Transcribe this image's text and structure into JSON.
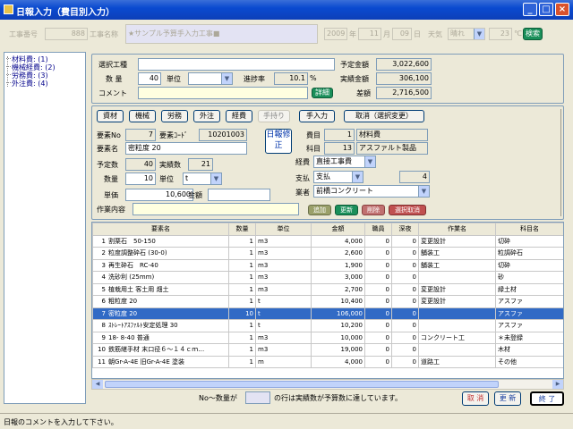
{
  "window": {
    "title": "日報入力（費目別入力）"
  },
  "header": {
    "kouji_no_label": "工事番号",
    "kouji_no": "888",
    "kouji_name_label": "工事名称",
    "kouji_name": "★サンプル予算手入力工事■",
    "year": "2009",
    "year_unit": "年",
    "month": "11",
    "month_unit": "月",
    "day": "09",
    "day_unit": "日",
    "weather_label": "天気",
    "weather": "晴れ",
    "temp": "23",
    "temp_unit": "℃",
    "search_btn": "検索"
  },
  "sidebar": {
    "items": [
      {
        "label": "材料費: (1)"
      },
      {
        "label": "機械経費: (2)"
      },
      {
        "label": "労務費: (3)"
      },
      {
        "label": "外注費: (4)"
      }
    ]
  },
  "top_panel": {
    "select_label": "選択工種",
    "select_value": "",
    "qty_label": "数 量",
    "qty": "40",
    "unit_label": "単位",
    "unit": "",
    "rate_label": "進捗率",
    "rate": "10.1",
    "rate_unit": "%",
    "comment_label": "コメント",
    "comment": "",
    "detail_btn": "詳細",
    "budget_label": "予定金額",
    "budget": "3,022,600",
    "actual_label": "実績金額",
    "actual": "306,100",
    "diff_label": "差額",
    "diff": "2,716,500"
  },
  "tabs": [
    {
      "label": "資材"
    },
    {
      "label": "機械"
    },
    {
      "label": "労務"
    },
    {
      "label": "外注"
    },
    {
      "label": "経費"
    },
    {
      "label": "手持り"
    },
    {
      "label": "手入力"
    }
  ],
  "cancel_select_btn": "取消（選択変更）",
  "detail": {
    "youso_no_label": "要素No",
    "youso_no": "7",
    "youso_code_label": "要素ｺｰﾄﾞ",
    "youso_code": "10201003",
    "nippo_btn": "日報修正",
    "himoku_label": "費目",
    "himoku_no": "1",
    "himoku_name": "材料費",
    "youso_name_label": "要素名",
    "youso_name": "密粒度 20",
    "kamoku_label": "科目",
    "kamoku_no": "13",
    "kamoku_name": "アスファルト製品",
    "yotei_qty_label": "予定数",
    "yotei_qty": "40",
    "jisseki_qty_label": "実績数",
    "jisseki_qty": "21",
    "keihi_label": "経費",
    "keihi": "直接工事費",
    "qty_label": "数量",
    "qty": "10",
    "unit_label": "単位",
    "unit": "t",
    "shiharai_label": "支払",
    "shiharai": "支払",
    "shiharai_no": "4",
    "tanka_label": "単価",
    "tanka": "10,600",
    "kingaku_label": "金額",
    "kingaku": "",
    "gyousha_label": "業者",
    "gyousha": "前橋コンクリート",
    "work_label": "作業内容",
    "work": "",
    "btn_add": "追加",
    "btn_update": "更新",
    "btn_delete": "削除",
    "btn_cancel": "選択取消"
  },
  "table": {
    "headers": [
      "要素名",
      "数量",
      "単位",
      "金額",
      "職員",
      "深夜",
      "作業名",
      "科目名"
    ],
    "rows": [
      {
        "no": "1",
        "name": "割栗石　50-150",
        "qty": "1",
        "unit": "m3",
        "amount": "4,000",
        "staff": "0",
        "night": "0",
        "work": "変更設計",
        "kamoku": "切砕"
      },
      {
        "no": "2",
        "name": "粒度調整砕石 (30-0)",
        "qty": "1",
        "unit": "m3",
        "amount": "2,600",
        "staff": "0",
        "night": "0",
        "work": "舗装工",
        "kamoku": "粒調砕石"
      },
      {
        "no": "3",
        "name": "再生砕石　RC-40",
        "qty": "1",
        "unit": "m3",
        "amount": "1,900",
        "staff": "0",
        "night": "0",
        "work": "舗装工",
        "kamoku": "切砕"
      },
      {
        "no": "4",
        "name": "洗砂利 (25mm)",
        "qty": "1",
        "unit": "m3",
        "amount": "3,000",
        "staff": "0",
        "night": "0",
        "work": "",
        "kamoku": "砂"
      },
      {
        "no": "5",
        "name": "植栽用土 客土用 畑土",
        "qty": "1",
        "unit": "m3",
        "amount": "2,700",
        "staff": "0",
        "night": "0",
        "work": "変更設計",
        "kamoku": "緑土材"
      },
      {
        "no": "6",
        "name": "粗粒度 20",
        "qty": "1",
        "unit": "t",
        "amount": "10,400",
        "staff": "0",
        "night": "0",
        "work": "変更設計",
        "kamoku": "アスファ"
      },
      {
        "no": "7",
        "name": "密粒度 20",
        "qty": "10",
        "unit": "t",
        "amount": "106,000",
        "staff": "0",
        "night": "0",
        "work": "",
        "kamoku": "アスファ"
      },
      {
        "no": "8",
        "name": "ｽﾄﾚｰﾄｱｽﾌｧﾙﾄ安定処理 30",
        "qty": "1",
        "unit": "t",
        "amount": "10,200",
        "staff": "0",
        "night": "0",
        "work": "",
        "kamoku": "アスファ"
      },
      {
        "no": "9",
        "name": "18- 8-40 普通",
        "qty": "1",
        "unit": "m3",
        "amount": "10,000",
        "staff": "0",
        "night": "0",
        "work": "コンクリート工",
        "kamoku": "＊未登録"
      },
      {
        "no": "10",
        "name": "鉄筋継手材 末口径６～１４ｃｍ…",
        "qty": "1",
        "unit": "m3",
        "amount": "19,000",
        "staff": "0",
        "night": "0",
        "work": "",
        "kamoku": "木材"
      },
      {
        "no": "11",
        "name": "朝Gr-A-4E 旧Gr-A-4E 塗装",
        "qty": "1",
        "unit": "m",
        "amount": "4,000",
        "staff": "0",
        "night": "0",
        "work": "道路工",
        "kamoku": "その他"
      }
    ],
    "selected_row": 6
  },
  "footer": {
    "msg_left": "No～数量が",
    "msg_right": "の行は実績数が予算数に達しています。",
    "btn_cancel": "取 消",
    "btn_update": "更 新",
    "btn_end": "終 了"
  },
  "status": {
    "text": "日報のコメントを入力して下さい。"
  }
}
